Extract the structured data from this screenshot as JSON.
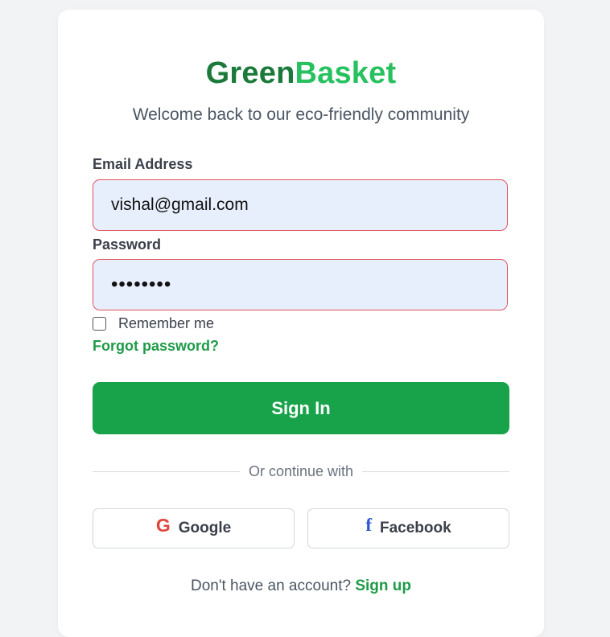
{
  "brand": {
    "part1": "Green",
    "part2": "Basket"
  },
  "subtitle": "Welcome back to our eco-friendly community",
  "email": {
    "label": "Email Address",
    "value": "vishal@gmail.com"
  },
  "password": {
    "label": "Password",
    "masked_value": "••••••••"
  },
  "remember": {
    "label": "Remember me",
    "checked": false
  },
  "forgot_label": "Forgot password?",
  "signin_label": "Sign In",
  "divider_text": "Or continue with",
  "social": {
    "google": {
      "icon": "G",
      "label": "Google"
    },
    "facebook": {
      "icon": "f",
      "label": "Facebook"
    }
  },
  "signup": {
    "prompt": "Don't have an account?",
    "link": "Sign up"
  },
  "colors": {
    "brand_dark": "#1b7a3a",
    "brand_light": "#27c15f",
    "primary": "#18a34a",
    "error_border": "#e0535a",
    "input_bg": "#e8effc"
  }
}
